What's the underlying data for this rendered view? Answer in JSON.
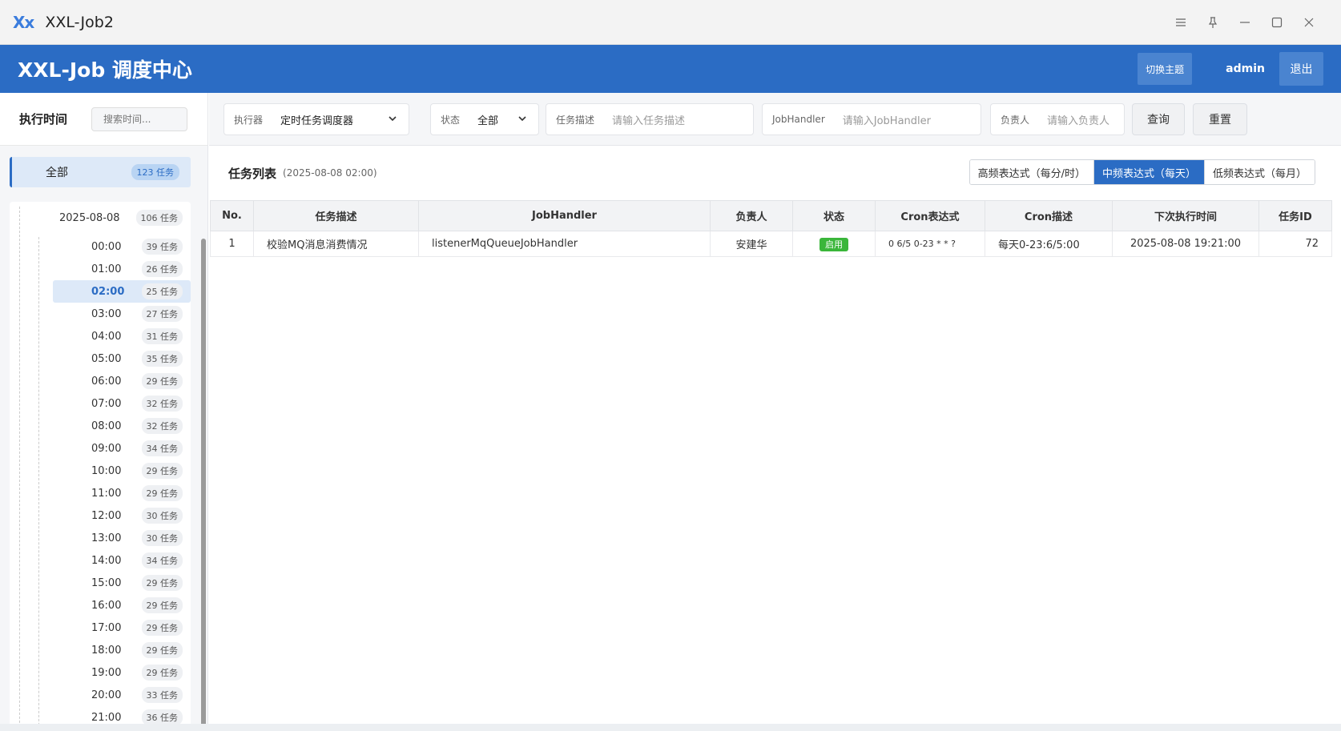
{
  "window": {
    "logo": "Xx",
    "title": "XXL-Job2"
  },
  "header": {
    "title": "XXL-Job 调度中心",
    "theme_label": "切换主题",
    "user": "admin",
    "logout_label": "退出"
  },
  "sidebar": {
    "title": "执行时间",
    "search_placeholder": "搜索时间...",
    "all": {
      "label": "全部",
      "badge": "123 任务"
    },
    "date": {
      "label": "2025-08-08",
      "badge": "106 任务"
    },
    "hours": [
      {
        "label": "00:00",
        "badge": "39 任务"
      },
      {
        "label": "01:00",
        "badge": "26 任务"
      },
      {
        "label": "02:00",
        "badge": "25 任务",
        "active": true
      },
      {
        "label": "03:00",
        "badge": "27 任务"
      },
      {
        "label": "04:00",
        "badge": "31 任务"
      },
      {
        "label": "05:00",
        "badge": "35 任务"
      },
      {
        "label": "06:00",
        "badge": "29 任务"
      },
      {
        "label": "07:00",
        "badge": "32 任务"
      },
      {
        "label": "08:00",
        "badge": "32 任务"
      },
      {
        "label": "09:00",
        "badge": "34 任务"
      },
      {
        "label": "10:00",
        "badge": "29 任务"
      },
      {
        "label": "11:00",
        "badge": "29 任务"
      },
      {
        "label": "12:00",
        "badge": "30 任务"
      },
      {
        "label": "13:00",
        "badge": "30 任务"
      },
      {
        "label": "14:00",
        "badge": "34 任务"
      },
      {
        "label": "15:00",
        "badge": "29 任务"
      },
      {
        "label": "16:00",
        "badge": "29 任务"
      },
      {
        "label": "17:00",
        "badge": "29 任务"
      },
      {
        "label": "18:00",
        "badge": "29 任务"
      },
      {
        "label": "19:00",
        "badge": "29 任务"
      },
      {
        "label": "20:00",
        "badge": "33 任务"
      },
      {
        "label": "21:00",
        "badge": "36 任务"
      }
    ]
  },
  "filters": {
    "executor": {
      "label": "执行器",
      "value": "定时任务调度器"
    },
    "status": {
      "label": "状态",
      "value": "全部"
    },
    "desc": {
      "label": "任务描述",
      "placeholder": "请输入任务描述"
    },
    "handler": {
      "label": "JobHandler",
      "placeholder": "请输入JobHandler"
    },
    "owner": {
      "label": "负责人",
      "placeholder": "请输入负责人"
    },
    "query_label": "查询",
    "reset_label": "重置"
  },
  "list": {
    "title": "任务列表",
    "subtitle": "(2025-08-08 02:00)",
    "freq": [
      "高频表达式（每分/时）",
      "中频表达式（每天）",
      "低频表达式（每月）"
    ],
    "freq_active": 1
  },
  "table": {
    "headers": [
      "No.",
      "任务描述",
      "JobHandler",
      "负责人",
      "状态",
      "Cron表达式",
      "Cron描述",
      "下次执行时间",
      "任务ID"
    ],
    "rows": [
      {
        "no": "1",
        "desc": "校验MQ消息消费情况",
        "handler": "listenerMqQueueJobHandler",
        "owner": "安建华",
        "status": "启用",
        "cron": "0 6/5 0-23 * * ?",
        "cron_desc": "每天0-23:6/5:00",
        "next_time": "2025-08-08 19:21:00",
        "id": "72"
      }
    ]
  },
  "colors": {
    "accent": "#2b6cc4",
    "status_enabled": "#3ab63a"
  }
}
